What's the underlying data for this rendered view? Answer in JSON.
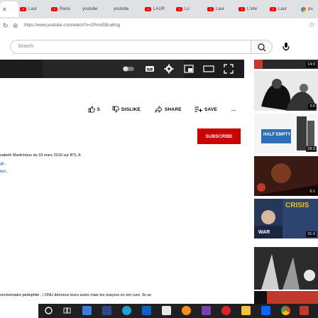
{
  "tabs": [
    {
      "label": "Laur"
    },
    {
      "label": "Racis"
    },
    {
      "label": "youtube"
    },
    {
      "label": "youtube"
    },
    {
      "label": "LAUR"
    },
    {
      "label": "Lo"
    },
    {
      "label": "Laur"
    },
    {
      "label": "L'inte"
    },
    {
      "label": "Laur"
    },
    {
      "label": "pu"
    }
  ],
  "address": {
    "url": "https://www.youtube.com/watch?v=2PmvEBLwKsg"
  },
  "search": {
    "placeholder": "Search"
  },
  "actions": {
    "likes": "5",
    "dislike": "DISLIKE",
    "share": "SHARE",
    "save": "SAVE",
    "more": "..."
  },
  "subscribe_label": "SUBSCRIBE",
  "description": {
    "line1": "zabeth Martichoux du 18 mars 2019 sur RTL.fr.",
    "line2": "gjl...",
    "line3": "tbd...",
    "bottom": "onctionnaire pédophile , l ONU dénonce leurs actes mais les maçons en ont cure. Ils se"
  },
  "sidebar_durations": [
    "14:0",
    "2:0",
    "28:2",
    "6:1",
    "31:3"
  ],
  "thumb_texts": {
    "crisis": "CRISIS",
    "war": "WAR",
    "half_empty": "HALF EMPTY"
  },
  "colors": {
    "youtube_red": "#ff0000",
    "subscribe_red": "#cc0000",
    "player_bg": "#1d1d1d"
  }
}
